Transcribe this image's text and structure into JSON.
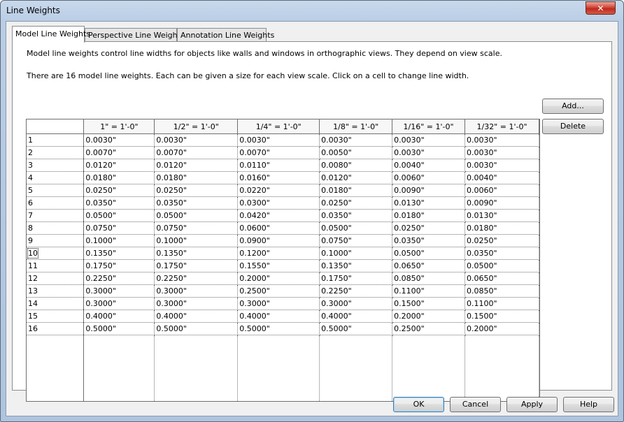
{
  "window": {
    "title": "Line Weights",
    "close_glyph": "✕"
  },
  "tabs": [
    "Model Line Weights",
    "Perspective Line Weights",
    "Annotation Line Weights"
  ],
  "description": {
    "line1": "Model line weights control line widths for objects like walls and windows in orthographic views. They depend on view scale.",
    "line2": "There are 16 model line weights. Each can be given a size for each view scale. Click on a cell to change line width."
  },
  "table": {
    "columns": [
      "1\" = 1'-0\"",
      "1/2\" = 1'-0\"",
      "1/4\" = 1'-0\"",
      "1/8\" = 1'-0\"",
      "1/16\" = 1'-0\"",
      "1/32\" = 1'-0\""
    ],
    "rows": [
      {
        "label": "1",
        "values": [
          "0.0030\"",
          "0.0030\"",
          "0.0030\"",
          "0.0030\"",
          "0.0030\"",
          "0.0030\""
        ]
      },
      {
        "label": "2",
        "values": [
          "0.0070\"",
          "0.0070\"",
          "0.0070\"",
          "0.0050\"",
          "0.0030\"",
          "0.0030\""
        ]
      },
      {
        "label": "3",
        "values": [
          "0.0120\"",
          "0.0120\"",
          "0.0110\"",
          "0.0080\"",
          "0.0040\"",
          "0.0030\""
        ]
      },
      {
        "label": "4",
        "values": [
          "0.0180\"",
          "0.0180\"",
          "0.0160\"",
          "0.0120\"",
          "0.0060\"",
          "0.0040\""
        ]
      },
      {
        "label": "5",
        "values": [
          "0.0250\"",
          "0.0250\"",
          "0.0220\"",
          "0.0180\"",
          "0.0090\"",
          "0.0060\""
        ]
      },
      {
        "label": "6",
        "values": [
          "0.0350\"",
          "0.0350\"",
          "0.0300\"",
          "0.0250\"",
          "0.0130\"",
          "0.0090\""
        ]
      },
      {
        "label": "7",
        "values": [
          "0.0500\"",
          "0.0500\"",
          "0.0420\"",
          "0.0350\"",
          "0.0180\"",
          "0.0130\""
        ]
      },
      {
        "label": "8",
        "values": [
          "0.0750\"",
          "0.0750\"",
          "0.0600\"",
          "0.0500\"",
          "0.0250\"",
          "0.0180\""
        ]
      },
      {
        "label": "9",
        "values": [
          "0.1000\"",
          "0.1000\"",
          "0.0900\"",
          "0.0750\"",
          "0.0350\"",
          "0.0250\""
        ]
      },
      {
        "label": "10",
        "values": [
          "0.1350\"",
          "0.1350\"",
          "0.1200\"",
          "0.1000\"",
          "0.0500\"",
          "0.0350\""
        ]
      },
      {
        "label": "11",
        "values": [
          "0.1750\"",
          "0.1750\"",
          "0.1550\"",
          "0.1350\"",
          "0.0650\"",
          "0.0500\""
        ]
      },
      {
        "label": "12",
        "values": [
          "0.2250\"",
          "0.2250\"",
          "0.2000\"",
          "0.1750\"",
          "0.0850\"",
          "0.0650\""
        ]
      },
      {
        "label": "13",
        "values": [
          "0.3000\"",
          "0.3000\"",
          "0.2500\"",
          "0.2250\"",
          "0.1100\"",
          "0.0850\""
        ]
      },
      {
        "label": "14",
        "values": [
          "0.3000\"",
          "0.3000\"",
          "0.3000\"",
          "0.3000\"",
          "0.1500\"",
          "0.1100\""
        ]
      },
      {
        "label": "15",
        "values": [
          "0.4000\"",
          "0.4000\"",
          "0.4000\"",
          "0.4000\"",
          "0.2000\"",
          "0.1500\""
        ]
      },
      {
        "label": "16",
        "values": [
          "0.5000\"",
          "0.5000\"",
          "0.5000\"",
          "0.5000\"",
          "0.2500\"",
          "0.2000\""
        ]
      }
    ],
    "selected_row": "10"
  },
  "side_buttons": {
    "add": "Add...",
    "delete": "Delete"
  },
  "footer_buttons": {
    "ok": "OK",
    "cancel": "Cancel",
    "apply": "Apply",
    "help": "Help"
  }
}
